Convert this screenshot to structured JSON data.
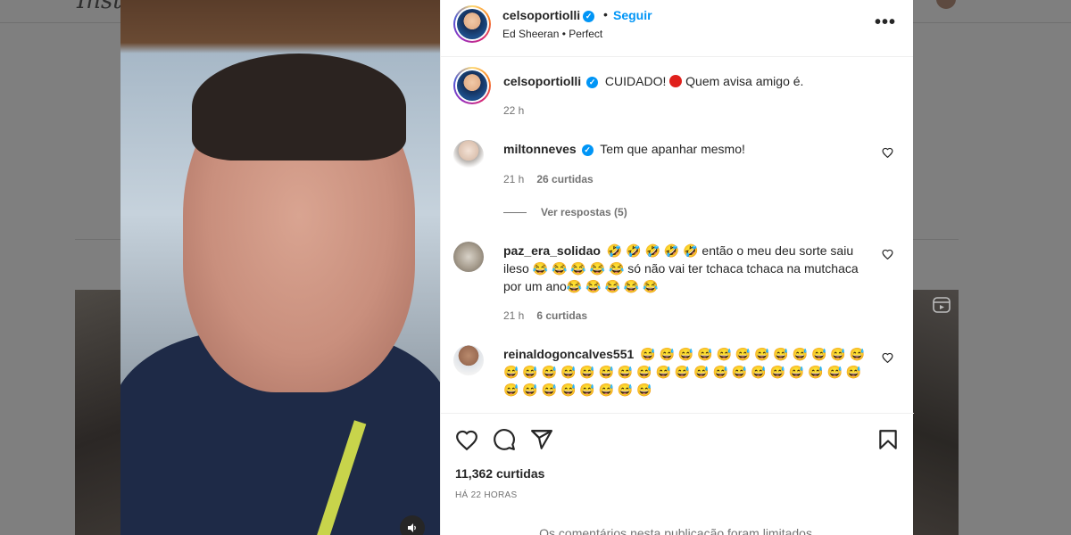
{
  "background": {
    "logo_text": "Insta"
  },
  "post": {
    "username": "celsoportiolli",
    "follow_label": "Seguir",
    "separator": "•",
    "audio": "Ed Sheeran • Perfect",
    "more_label": "•••"
  },
  "caption": {
    "username": "celsoportiolli",
    "text_before": "CUIDADO!",
    "text_after": "Quem avisa amigo é.",
    "time": "22 h"
  },
  "comments": [
    {
      "username": "miltonneves",
      "verified": true,
      "text": "Tem que apanhar mesmo!",
      "time": "21 h",
      "likes": "26 curtidas",
      "replies": "Ver respostas (5)"
    },
    {
      "username": "paz_era_solidao",
      "verified": false,
      "text": "🤣 🤣 🤣 🤣 🤣 então o meu deu sorte saiu ileso 😂 😂 😂 😂 😂 só não vai ter tchaca tchaca na mutchaca por um ano😂 😂 😂 😂 😂",
      "time": "21 h",
      "likes": "6 curtidas"
    },
    {
      "username": "reinaldogoncalves551",
      "verified": false,
      "text": "😅 😅 😅 😅 😅 😅 😅 😅 😅 😅 😅 😅 😅 😅 😅 😅 😅 😅 😅 😅 😅 😅 😅 😅 😅 😅 😅 😅 😅 😅 😅 😅 😅 😅 😅 😅 😅 😅 😅"
    }
  ],
  "actions": {
    "likes_count": "11,362 curtidas",
    "post_time": "HÁ 22 HORAS",
    "limited_notice": "Os comentários nesta publicação foram limitados."
  },
  "icons": {
    "like": "heart-icon",
    "comment": "comment-icon",
    "share": "paper-plane-icon",
    "save": "bookmark-icon",
    "sound": "speaker-icon"
  },
  "colors": {
    "accent": "#0095f6",
    "text": "#262626",
    "muted": "#737373",
    "overlay": "#7f7f7f"
  }
}
